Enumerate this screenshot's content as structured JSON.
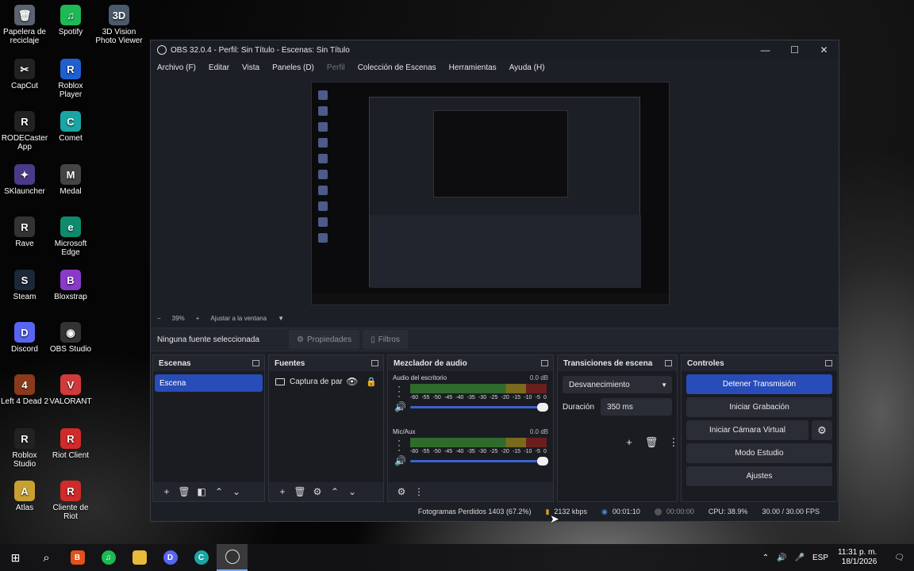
{
  "desktop": {
    "icons": [
      {
        "label": "Papelera de reciclaje",
        "glyph": "🗑",
        "color": "#5a6470"
      },
      {
        "label": "CapCut",
        "glyph": "✂",
        "color": "#222222"
      },
      {
        "label": "RODECaster App",
        "glyph": "R",
        "color": "#222222"
      },
      {
        "label": "SKlauncher",
        "glyph": "✦",
        "color": "#4b3a8a"
      },
      {
        "label": "Rave",
        "glyph": "R",
        "color": "#333333"
      },
      {
        "label": "Steam",
        "glyph": "S",
        "color": "#1b2838"
      },
      {
        "label": "Discord",
        "glyph": "D",
        "color": "#5865f2"
      },
      {
        "label": "Left 4 Dead 2",
        "glyph": "4",
        "color": "#8a3a1a"
      },
      {
        "label": "Roblox Studio",
        "glyph": "R",
        "color": "#222222"
      },
      {
        "label": "Atlas",
        "glyph": "A",
        "color": "#c8a030"
      },
      {
        "label": "Spotify",
        "glyph": "♫",
        "color": "#1db954"
      },
      {
        "label": "Roblox Player",
        "glyph": "R",
        "color": "#1f5fd0"
      },
      {
        "label": "Comet",
        "glyph": "C",
        "color": "#1aa5a5"
      },
      {
        "label": "Medal",
        "glyph": "M",
        "color": "#444444"
      },
      {
        "label": "Microsoft Edge",
        "glyph": "e",
        "color": "#0f8a6f"
      },
      {
        "label": "Bloxstrap",
        "glyph": "B",
        "color": "#8a3ac8"
      },
      {
        "label": "OBS Studio",
        "glyph": "◉",
        "color": "#333333"
      },
      {
        "label": "VALORANT",
        "glyph": "V",
        "color": "#d03a3a"
      },
      {
        "label": "Riot Client",
        "glyph": "R",
        "color": "#d02a2a"
      },
      {
        "label": "Cliente de Riot",
        "glyph": "R",
        "color": "#d02a2a"
      },
      {
        "label": "3D Vision Photo Viewer",
        "glyph": "3D",
        "color": "#4a5a6a"
      }
    ]
  },
  "window": {
    "title": "OBS 32.0.4 - Perfil: Sin Título - Escenas: Sin Título",
    "minimize": "—",
    "maximize": "☐",
    "close": "✕"
  },
  "menu": {
    "archivo": "Archivo (F)",
    "editar": "Editar",
    "vista": "Vista",
    "paneles": "Paneles (D)",
    "perfil": "Perfil",
    "coleccion": "Colección de Escenas",
    "herramientas": "Herramientas",
    "ayuda": "Ayuda (H)"
  },
  "zoom": {
    "minus": "−",
    "value": "39%",
    "plus": "+",
    "fit": "Ajustar a la ventana",
    "dropdown": "▼"
  },
  "sourcebar": {
    "no_source": "Ninguna fuente seleccionada",
    "properties": "Propiedades",
    "filters": "Filtros"
  },
  "scenes": {
    "title": "Escenas",
    "items": [
      "Escena"
    ]
  },
  "sources": {
    "title": "Fuentes",
    "items": [
      "Captura de par"
    ]
  },
  "mixer": {
    "title": "Mezclador de audio",
    "channels": [
      {
        "name": "Audio del escritorio",
        "db": "0.0 dB"
      },
      {
        "name": "Mic/Aux",
        "db": "0.0 dB"
      }
    ],
    "ticks": [
      "-60",
      "-55",
      "-50",
      "-45",
      "-40",
      "-35",
      "-30",
      "-25",
      "-20",
      "-15",
      "-10",
      "-5",
      "0"
    ]
  },
  "transitions": {
    "title": "Transiciones de escena",
    "selected": "Desvanecimiento",
    "duration_label": "Duración",
    "duration_value": "350 ms"
  },
  "controls": {
    "title": "Controles",
    "stop_stream": "Detener Transmisión",
    "start_record": "Iniciar Grabación",
    "start_vcam": "Iniciar Cámara Virtual",
    "studio_mode": "Modo Estudio",
    "settings": "Ajustes"
  },
  "status": {
    "dropped": "Fotogramas Perdidos 1403 (67.2%)",
    "bitrate": "2132 kbps",
    "stream_time": "00:01:10",
    "record_time": "00:00:00",
    "cpu": "CPU: 38.9%",
    "fps": "30.00 / 30.00 FPS"
  },
  "taskbar": {
    "lang": "ESP",
    "time": "11:31 p. m.",
    "date": "18/1/2026"
  },
  "colors": {
    "accent": "#284cb8",
    "panel": "#22252d",
    "window": "#1d1f26"
  }
}
